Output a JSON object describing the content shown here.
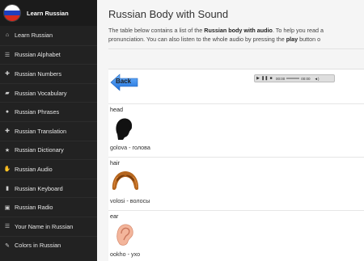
{
  "sidebar": {
    "brand": "Learn Russian",
    "items": [
      {
        "label": "Learn Russian",
        "icon": "home-icon",
        "glyph": "⌂"
      },
      {
        "label": "Russian Alphabet",
        "icon": "list-icon",
        "glyph": "☰"
      },
      {
        "label": "Russian Numbers",
        "icon": "plus-icon",
        "glyph": "✚"
      },
      {
        "label": "Russian Vocabulary",
        "icon": "book-icon",
        "glyph": "▰"
      },
      {
        "label": "Russian Phrases",
        "icon": "globe-icon",
        "glyph": "●"
      },
      {
        "label": "Russian Translation",
        "icon": "plus-icon",
        "glyph": "✚"
      },
      {
        "label": "Russian Dictionary",
        "icon": "star-icon",
        "glyph": "★"
      },
      {
        "label": "Russian Audio",
        "icon": "thumbs-up-icon",
        "glyph": "✋"
      },
      {
        "label": "Russian Keyboard",
        "icon": "file-icon",
        "glyph": "▮"
      },
      {
        "label": "Russian Radio",
        "icon": "radio-icon",
        "glyph": "▣"
      },
      {
        "label": "Your Name in Russian",
        "icon": "list-icon",
        "glyph": "☰"
      },
      {
        "label": "Colors in Russian",
        "icon": "pin-icon",
        "glyph": "✎"
      }
    ]
  },
  "main": {
    "title": "Russian Body with Sound",
    "intro_pre": "The table below contains a list of the ",
    "intro_bold1": "Russian body with audio",
    "intro_mid": ". To help you read a",
    "intro_line2_pre": "pronunciation. You can also listen to the whole audio by pressing the ",
    "intro_bold2": "play",
    "intro_line2_post": " button o"
  },
  "back_button": {
    "label": "Back"
  },
  "player": {
    "play": "▶",
    "pause": "❚❚",
    "stop": "■",
    "time_current": "00:00",
    "time_total": "00:00",
    "volume": "◄)"
  },
  "entries": [
    {
      "word": "head",
      "translit": "golova - голова",
      "icon": "head-silhouette-icon"
    },
    {
      "word": "hair",
      "translit": "volosi - волосы",
      "icon": "hair-icon"
    },
    {
      "word": "ear",
      "translit": "ookho - ухо",
      "icon": "ear-icon"
    }
  ]
}
